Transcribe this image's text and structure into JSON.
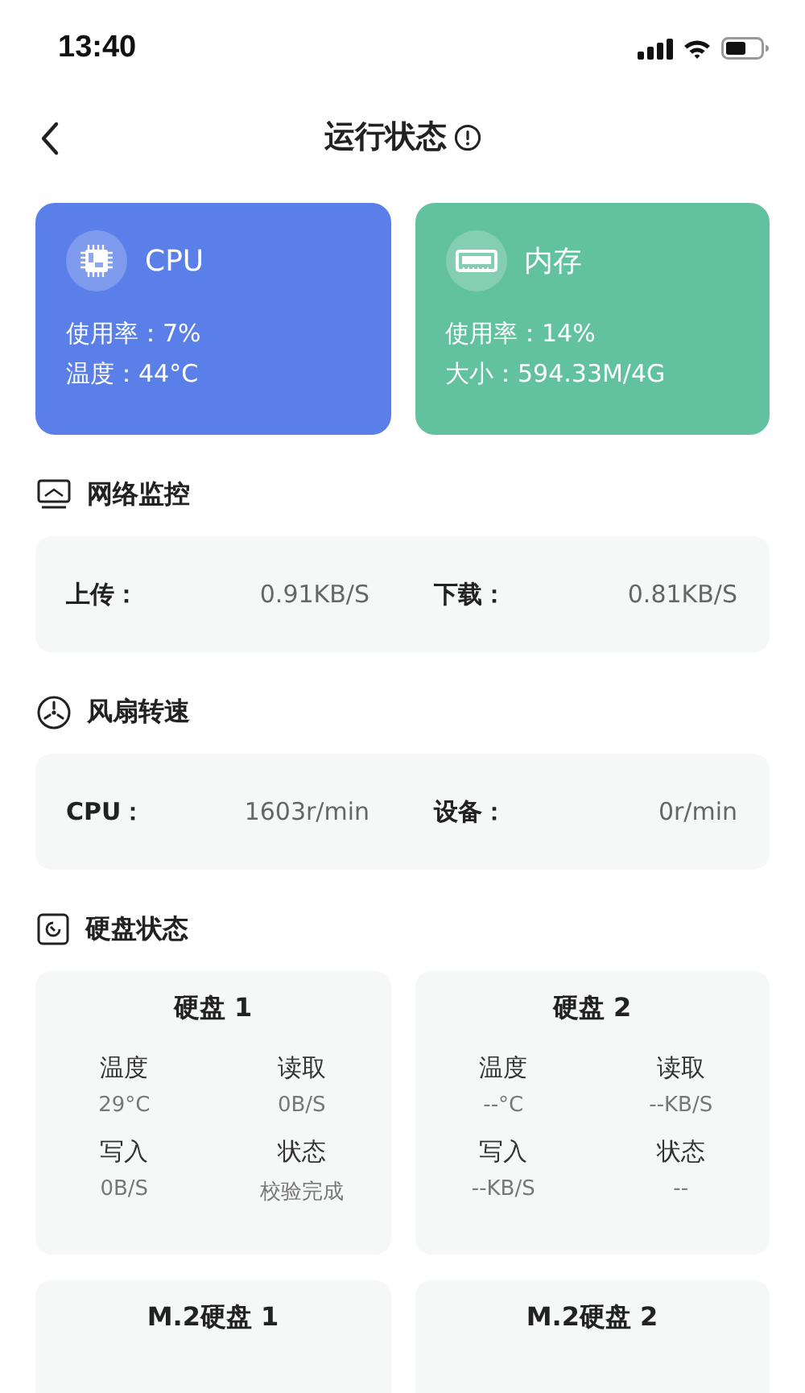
{
  "status_bar": {
    "time": "13:40"
  },
  "header": {
    "title": "运行状态"
  },
  "stat_cards": [
    {
      "kind": "cpu",
      "title": "CPU",
      "color": "#5b7fe8",
      "lines": [
        "使用率：7%",
        "温度：44°C"
      ]
    },
    {
      "kind": "memory",
      "title": "内存",
      "color": "#62c19e",
      "lines": [
        "使用率：14%",
        "大小：594.33M/4G"
      ]
    }
  ],
  "sections": [
    {
      "kind": "network",
      "title": "网络监控",
      "metrics": [
        {
          "label": "上传：",
          "value": "0.91KB/S"
        },
        {
          "label": "下载：",
          "value": "0.81KB/S"
        }
      ]
    },
    {
      "kind": "fan",
      "title": "风扇转速",
      "metrics": [
        {
          "label": "CPU：",
          "value": "1603r/min"
        },
        {
          "label": "设备：",
          "value": "0r/min"
        }
      ]
    },
    {
      "kind": "disk",
      "title": "硬盘状态",
      "disks": [
        {
          "title": "硬盘 1",
          "fields": [
            {
              "label": "温度",
              "value": "29°C"
            },
            {
              "label": "读取",
              "value": "0B/S"
            },
            {
              "label": "写入",
              "value": "0B/S"
            },
            {
              "label": "状态",
              "value": "校验完成"
            }
          ]
        },
        {
          "title": "硬盘 2",
          "fields": [
            {
              "label": "温度",
              "value": "--°C"
            },
            {
              "label": "读取",
              "value": "--KB/S"
            },
            {
              "label": "写入",
              "value": "--KB/S"
            },
            {
              "label": "状态",
              "value": "--"
            }
          ]
        },
        {
          "title": "M.2硬盘 1"
        },
        {
          "title": "M.2硬盘 2"
        }
      ]
    }
  ]
}
